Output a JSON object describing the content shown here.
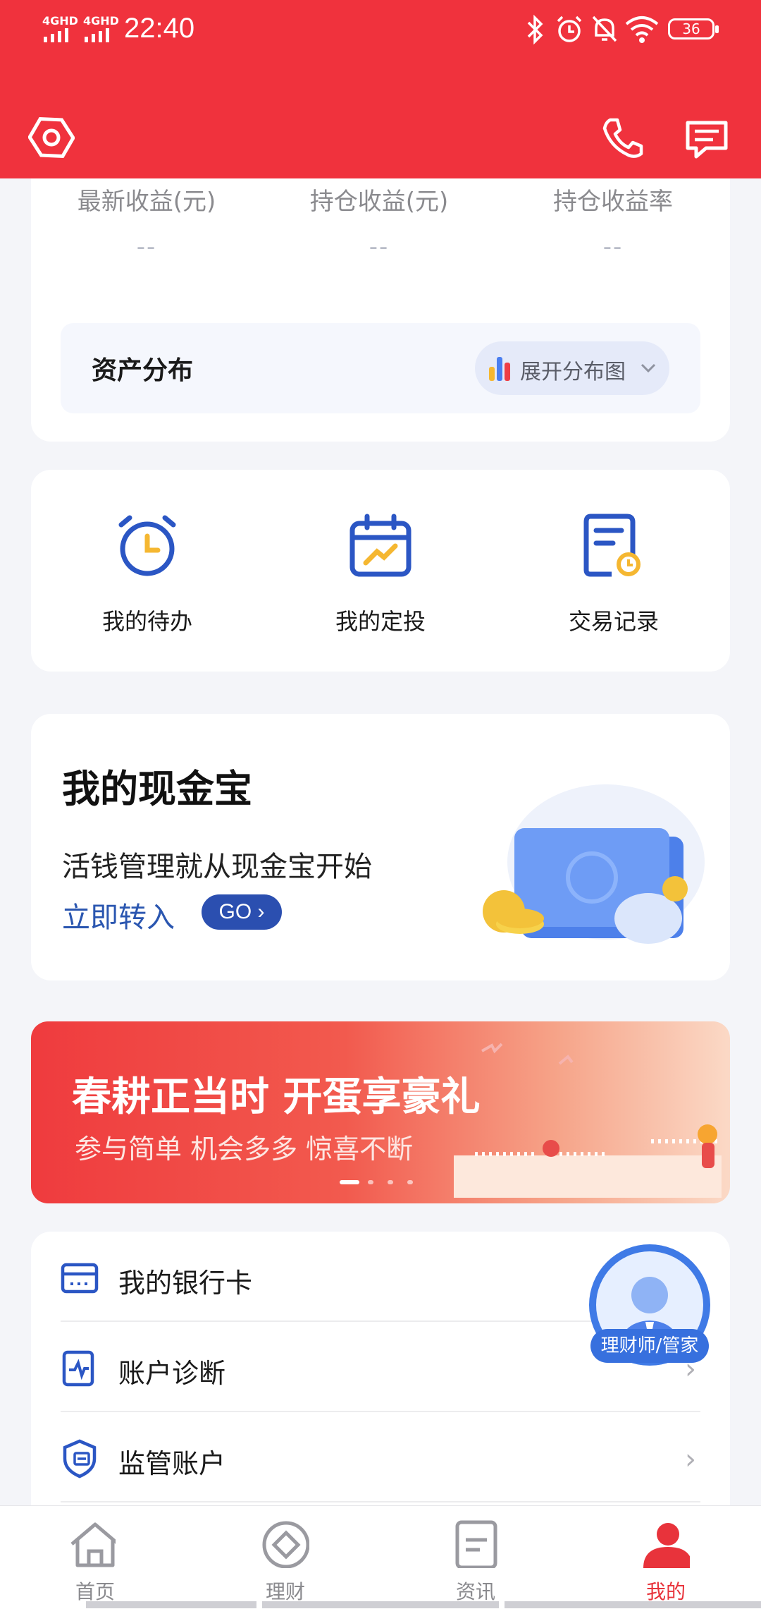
{
  "status": {
    "time": "22:40",
    "battery": "36",
    "signal_1": "4GHD",
    "signal_2": "4GHD"
  },
  "header": {
    "settings_icon": "hexagon-settings-icon",
    "phone_icon": "phone-icon",
    "message_icon": "message-icon"
  },
  "earnings": {
    "metrics": [
      {
        "label": "最新收益(元)",
        "value": "--"
      },
      {
        "label": "持仓收益(元)",
        "value": "--"
      },
      {
        "label": "持仓收益率",
        "value": "--"
      }
    ],
    "asset_distribution": {
      "label": "资产分布",
      "button": "展开分布图"
    }
  },
  "quick_actions": [
    {
      "label": "我的待办",
      "icon": "alarm-clock-icon"
    },
    {
      "label": "我的定投",
      "icon": "calendar-trend-icon"
    },
    {
      "label": "交易记录",
      "icon": "document-clock-icon"
    }
  ],
  "cash_treasure": {
    "title": "我的现金宝",
    "subtitle": "活钱管理就从现金宝开始",
    "link": "立即转入",
    "go": "GO"
  },
  "banner": {
    "title": "春耕正当时 开蛋享豪礼",
    "subtitle": "参与简单 机会多多 惊喜不断",
    "slide_count": 4,
    "active_slide": 1
  },
  "list": [
    {
      "label": "我的银行卡",
      "icon": "bank-card-icon"
    },
    {
      "label": "账户诊断",
      "icon": "diagnosis-icon"
    },
    {
      "label": "监管账户",
      "icon": "shield-account-icon"
    }
  ],
  "advisor": {
    "tag": "理财师/管家"
  },
  "nav": [
    {
      "label": "首页",
      "icon": "home-icon",
      "active": false
    },
    {
      "label": "理财",
      "icon": "finance-icon",
      "active": false
    },
    {
      "label": "资讯",
      "icon": "news-icon",
      "active": false
    },
    {
      "label": "我的",
      "icon": "profile-icon",
      "active": true
    }
  ],
  "colors": {
    "brand_red": "#f0323d",
    "accent_blue": "#2b4fb0",
    "icon_yellow": "#f5b731"
  }
}
